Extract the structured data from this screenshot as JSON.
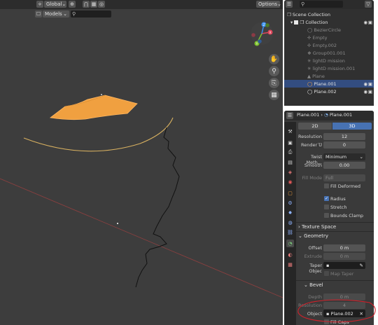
{
  "viewport": {
    "header": {
      "orientation": "Global",
      "snap_icon": "magnet-icon",
      "proportional_icon": "circle-dot-icon",
      "options_label": "Options"
    },
    "subheader": {
      "collection_mode": "Models",
      "search_placeholder": ""
    },
    "gizmo": {
      "x": "X",
      "y": "Y",
      "z": "Z"
    },
    "nav_icons": [
      "hand-icon",
      "zoom-icon",
      "camera-icon",
      "grid-icon"
    ]
  },
  "outliner": {
    "scene_label": "Scene Collection",
    "collection_label": "Collection",
    "items": [
      {
        "name": "BezierCircle",
        "dim": true
      },
      {
        "name": "Empty",
        "dim": true
      },
      {
        "name": "Empty.002",
        "dim": true
      },
      {
        "name": "Group001.001",
        "dim": true
      },
      {
        "name": "lightD mission",
        "dim": true
      },
      {
        "name": "lightD mission.001",
        "dim": true
      },
      {
        "name": "Plane",
        "dim": true
      },
      {
        "name": "Plane.001",
        "dim": false,
        "selected": true
      },
      {
        "name": "Plane.002",
        "dim": false
      }
    ]
  },
  "properties": {
    "header_object": "Plane.001",
    "header_data": "Plane.001",
    "tab_2d": "2D",
    "tab_3d": "3D",
    "fields": {
      "resolution_label": "Resolution ...",
      "resolution_value": "12",
      "render_u_label": "Render U",
      "render_u_value": "0",
      "twist_method_label": "Twist Meth...",
      "twist_method_value": "Minimum",
      "smooth_label": "Smooth",
      "smooth_value": "0.00",
      "fill_mode_label": "Fill Mode",
      "fill_mode_value": "Full",
      "fill_deformed_label": "Fill Deformed",
      "radius_label": "Radius",
      "stretch_label": "Stretch",
      "bounds_clamp_label": "Bounds Clamp"
    },
    "sections": {
      "texture_space": "Texture Space",
      "geometry": "Geometry",
      "bevel": "Bevel"
    },
    "geometry": {
      "offset_label": "Offset",
      "offset_value": "0 m",
      "extrude_label": "Extrude",
      "extrude_value": "0 m",
      "taper_label": "Taper Objec",
      "map_taper_label": "Map Taper"
    },
    "bevel": {
      "depth_label": "Depth",
      "depth_value": "0 m",
      "resolution_label": "Resolution",
      "resolution_value": "4",
      "object_label": "Object",
      "object_value": "Plane.002",
      "fill_caps_label": "Fill Caps"
    }
  },
  "colors": {
    "viewport_bg": "#3d3d3d",
    "selected_orange": "#f0a040",
    "accent_blue": "#4772b3",
    "annotation_red": "#d0202a",
    "x_axis": "#e0455a",
    "y_axis": "#7ec22e",
    "z_axis": "#3c8ff0"
  }
}
